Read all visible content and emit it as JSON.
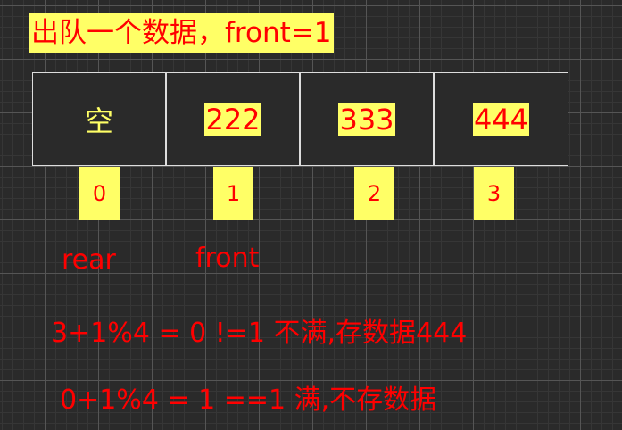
{
  "title": "出队一个数据，front=1",
  "cells": [
    "空",
    "222",
    "333",
    "444"
  ],
  "indices": [
    "0",
    "1",
    "2",
    "3"
  ],
  "pointers": {
    "rear": "rear",
    "front": "front"
  },
  "notes": [
    "3+1%4 = 0  !=1  不满,存数据444",
    "0+1%4 = 1  ==1  满,不存数据"
  ],
  "colors": {
    "highlight": "#ffff66",
    "text": "#ff0000",
    "background": "#2a2a2a"
  }
}
